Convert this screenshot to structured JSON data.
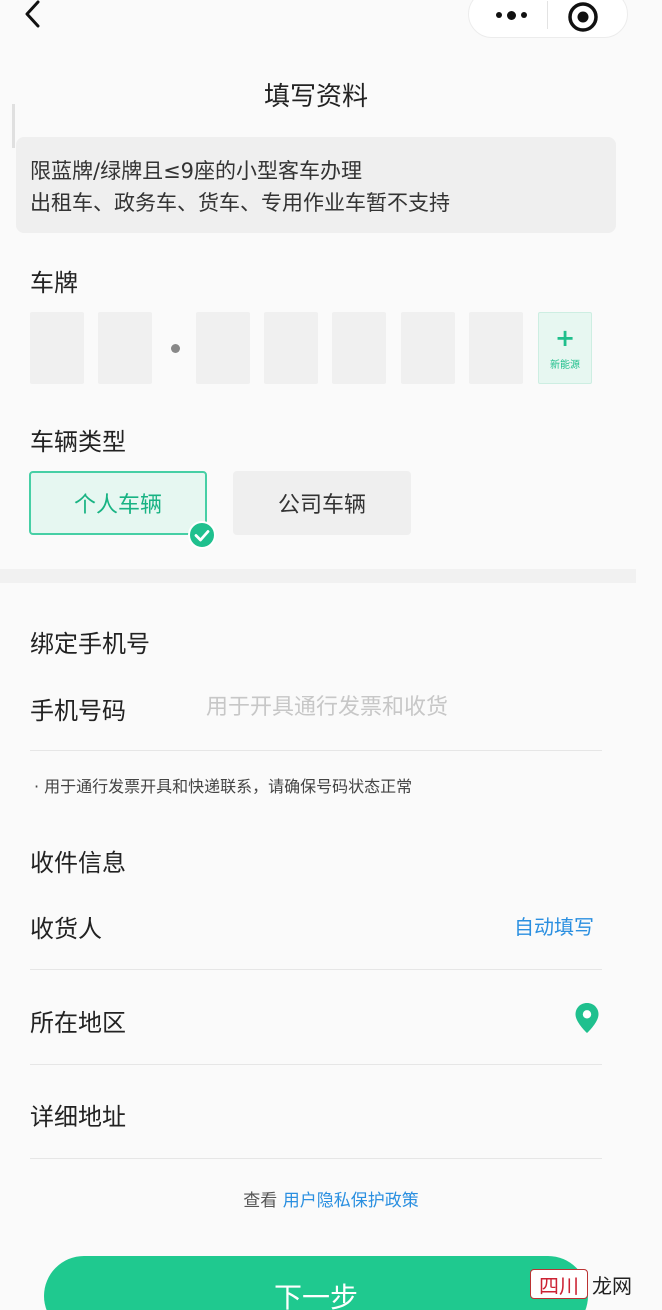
{
  "header": {
    "title": "填写资料"
  },
  "notice": {
    "line1": "限蓝牌/绿牌且≤9座的小型客车办理",
    "line2": "出租车、政务车、货车、专用作业车暂不支持"
  },
  "plate": {
    "label": "车牌",
    "new_energy_plus": "+",
    "new_energy_tag": "新能源"
  },
  "vehicle_type": {
    "label": "车辆类型",
    "options": [
      "个人车辆",
      "公司车辆"
    ],
    "selected": "个人车辆"
  },
  "phone": {
    "section_title": "绑定手机号",
    "label": "手机号码",
    "placeholder": "用于开具通行发票和收货",
    "value": "",
    "hint": "· 用于通行发票开具和快递联系，请确保号码状态正常"
  },
  "shipping": {
    "section_title": "收件信息",
    "receiver_label": "收货人",
    "auto_fill": "自动填写",
    "region_label": "所在地区",
    "address_label": "详细地址"
  },
  "privacy": {
    "prefix": "查看",
    "link": "用户隐私保护政策"
  },
  "next_button": "下一步",
  "watermark": {
    "part1": "四川",
    "part2": "龙网"
  },
  "colors": {
    "accent": "#1fc98f",
    "link": "#2a8fe0"
  },
  "icons": [
    "back-icon",
    "more-icon",
    "close-icon",
    "check-icon",
    "location-pin-icon"
  ]
}
